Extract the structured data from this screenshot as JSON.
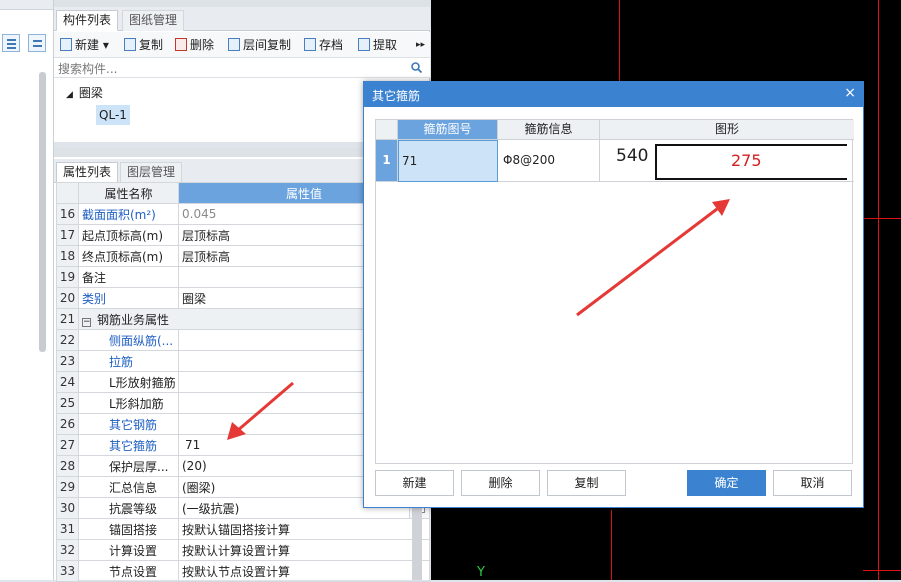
{
  "component_panel": {
    "tabs": [
      "构件列表",
      "图纸管理"
    ],
    "toolbar": [
      "新建",
      "复制",
      "删除",
      "层间复制",
      "存档",
      "提取"
    ],
    "more": "▸▸",
    "search_placeholder": "搜索构件...",
    "tree": {
      "root": "圈梁",
      "child": "QL-1"
    }
  },
  "property_panel": {
    "tabs": [
      "属性列表",
      "图层管理"
    ],
    "columns": [
      "属性名称",
      "属性值"
    ],
    "rows": [
      {
        "num": "16",
        "name": "截面面积(m²)",
        "value": "0.045"
      },
      {
        "num": "17",
        "name": "起点顶标高(m)",
        "value": "层顶标高"
      },
      {
        "num": "18",
        "name": "终点顶标高(m)",
        "value": "层顶标高"
      },
      {
        "num": "19",
        "name": "备注",
        "value": ""
      },
      {
        "num": "20",
        "name": "类别",
        "value": "圈梁"
      },
      {
        "num": "21",
        "name": "钢筋业务属性",
        "value": ""
      },
      {
        "num": "22",
        "name": "侧面纵筋(...",
        "value": ""
      },
      {
        "num": "23",
        "name": "拉筋",
        "value": ""
      },
      {
        "num": "24",
        "name": "L形放射箍筋",
        "value": ""
      },
      {
        "num": "25",
        "name": "L形斜加筋",
        "value": ""
      },
      {
        "num": "26",
        "name": "其它钢筋",
        "value": ""
      },
      {
        "num": "27",
        "name": "其它箍筋",
        "value": "71"
      },
      {
        "num": "28",
        "name": "保护层厚...",
        "value": "(20)"
      },
      {
        "num": "29",
        "name": "汇总信息",
        "value": "(圈梁)"
      },
      {
        "num": "30",
        "name": "抗震等级",
        "value": "(一级抗震)"
      },
      {
        "num": "31",
        "name": "锚固搭接",
        "value": "按默认锚固搭接计算"
      },
      {
        "num": "32",
        "name": "计算设置",
        "value": "按默认计算设置计算"
      },
      {
        "num": "33",
        "name": "节点设置",
        "value": "按默认节点设置计算"
      }
    ],
    "ellipsis": "···"
  },
  "cad": {
    "axis_label": "Y"
  },
  "dialog": {
    "title": "其它箍筋",
    "close": "×",
    "columns": [
      "箍筋图号",
      "箍筋信息",
      "图形"
    ],
    "row": {
      "index": "1",
      "code": "71",
      "info": "Φ8@200",
      "dim_left": "540",
      "dim_inner": "275"
    },
    "buttons": {
      "new": "新建",
      "delete": "删除",
      "copy": "复制",
      "ok": "确定",
      "cancel": "取消"
    }
  },
  "colors": {
    "accent": "#3b82d1",
    "cad_line": "#e01010",
    "arrow": "#e53935"
  }
}
